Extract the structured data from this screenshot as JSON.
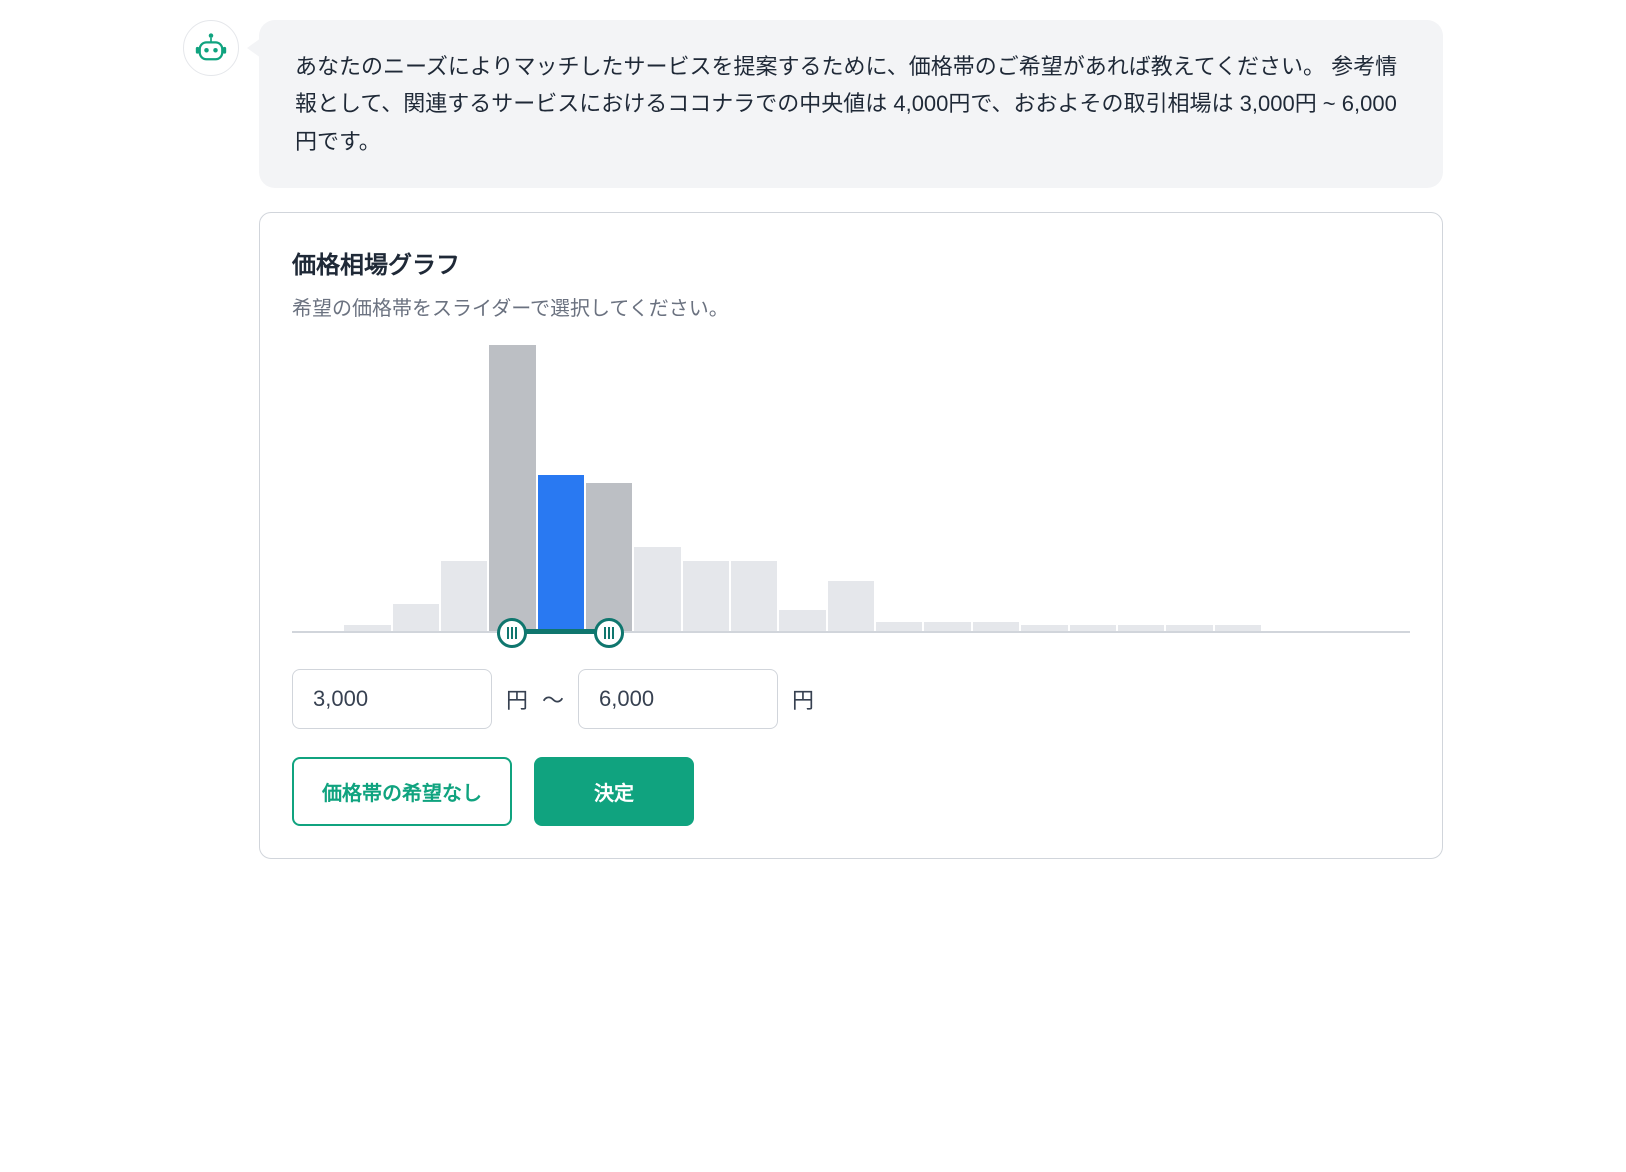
{
  "bot": {
    "message": "あなたのニーズによりマッチしたサービスを提案するために、価格帯のご希望があれば教えてください。 参考情報として、関連するサービスにおけるココナラでの中央値は 4,000円で、おおよその取引相場は 3,000円 ~ 6,000円です。"
  },
  "card": {
    "title": "価格相場グラフ",
    "subtitle": "希望の価格帯をスライダーで選択してください。"
  },
  "inputs": {
    "min_value": "3,000",
    "max_value": "6,000",
    "currency_unit": "円",
    "tilde": "〜"
  },
  "buttons": {
    "no_preference": "価格帯の希望なし",
    "decide": "決定"
  },
  "chart_data": {
    "type": "bar",
    "title": "価格相場グラフ",
    "xlabel": "",
    "ylabel": "",
    "categories_note": "price buckets, unlabeled on x-axis; implied 1000円-step bins",
    "values": [
      0,
      3,
      10,
      25,
      100,
      55,
      52,
      30,
      25,
      25,
      8,
      18,
      4,
      4,
      4,
      3,
      3,
      3,
      3,
      3,
      0,
      0,
      0
    ],
    "selected_range_idx": [
      5,
      5
    ],
    "adjacent_idx": [
      4,
      6
    ],
    "slider": {
      "min_idx": 4,
      "max_idx": 6
    }
  }
}
